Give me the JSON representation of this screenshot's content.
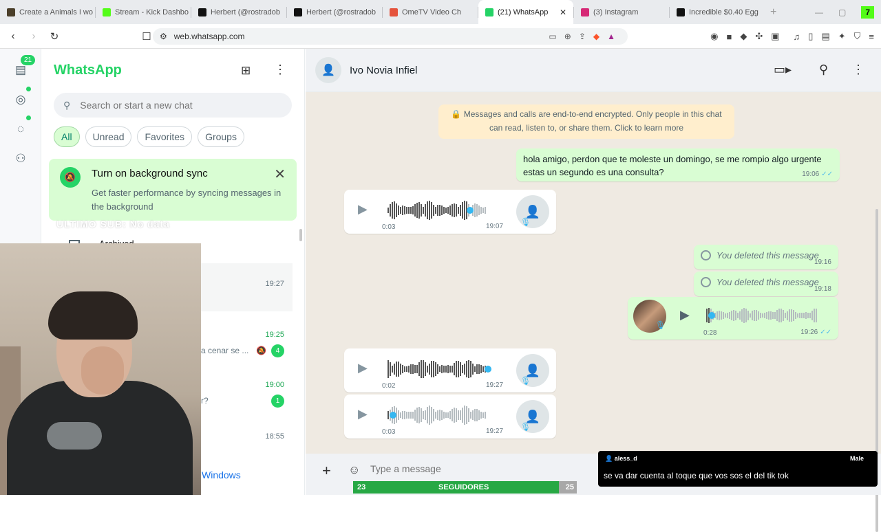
{
  "browser": {
    "tabs": [
      {
        "title": "Create a Animals I wo",
        "color": "#4b3f2a"
      },
      {
        "title": "Stream - Kick Dashbo",
        "color": "#53fc18"
      },
      {
        "title": "Herbert (@rostradob",
        "color": "#111111"
      },
      {
        "title": "Herbert (@rostradob",
        "color": "#111111"
      },
      {
        "title": "OmeTV Video Ch",
        "color": "#e5533c"
      },
      {
        "title": "(21) WhatsApp",
        "color": "#25d366"
      },
      {
        "title": "(3) Instagram",
        "color": "#d62976"
      },
      {
        "title": "Incredible $0.40 Egg",
        "color": "#111111"
      }
    ],
    "active_tab_index": 5,
    "url": "web.whatsapp.com",
    "corner_badge": "7"
  },
  "rail": {
    "unread_badge": "21"
  },
  "sidebar": {
    "app_title": "WhatsApp",
    "search_placeholder": "Search or start a new chat",
    "filters": [
      "All",
      "Unread",
      "Favorites",
      "Groups"
    ],
    "sync_banner": {
      "title": "Turn on background sync",
      "body": "Get faster performance by syncing messages in the background"
    },
    "overlay_text": "ULTIMO SUB: No data",
    "archived_label": "Archived",
    "rows": [
      {
        "time": "19:27",
        "preview": "",
        "unread": null,
        "muted": false,
        "green": false
      },
      {
        "time": "19:25",
        "preview": "a cenar se ...",
        "unread": "4",
        "muted": true,
        "green": true
      },
      {
        "time": "19:00",
        "preview": "r?",
        "unread": "1",
        "muted": false,
        "green": true
      },
      {
        "time": "18:55",
        "preview": "",
        "unread": null,
        "muted": false,
        "green": false
      }
    ],
    "activate_windows_text": "Windows"
  },
  "chat": {
    "contact_name": "Ivo Novia Infiel",
    "encryption_notice": "Messages and calls are end-to-end encrypted. Only people in this chat can read, listen to, or share them. Click to learn more",
    "messages": {
      "text_out": {
        "text_line1": "hola amigo, perdon que te moleste un domingo, se me rompio algo urgente",
        "text_line2": "estas un segundo es una consulta?",
        "time": "19:06"
      },
      "voice_in_1": {
        "duration": "0:03",
        "time": "19:07"
      },
      "deleted_1": {
        "text": "You deleted this message",
        "time": "19:16"
      },
      "deleted_2": {
        "text": "You deleted this message",
        "time": "19:18"
      },
      "voice_out": {
        "duration": "0:28",
        "time": "19:26"
      },
      "voice_in_2": {
        "duration": "0:02",
        "time": "19:27"
      },
      "voice_in_3": {
        "duration": "0:03",
        "time": "19:27"
      }
    },
    "composer_placeholder": "Type a message"
  },
  "stream_overlay": {
    "followers_label": "SEGUIDORES",
    "followers_current": "23",
    "followers_goal": "25",
    "followers_progress": 0.92,
    "ome_user": "aless_d",
    "ome_gender": "Male",
    "ome_message": "se va dar cuenta al toque que vos sos el del tik tok"
  }
}
